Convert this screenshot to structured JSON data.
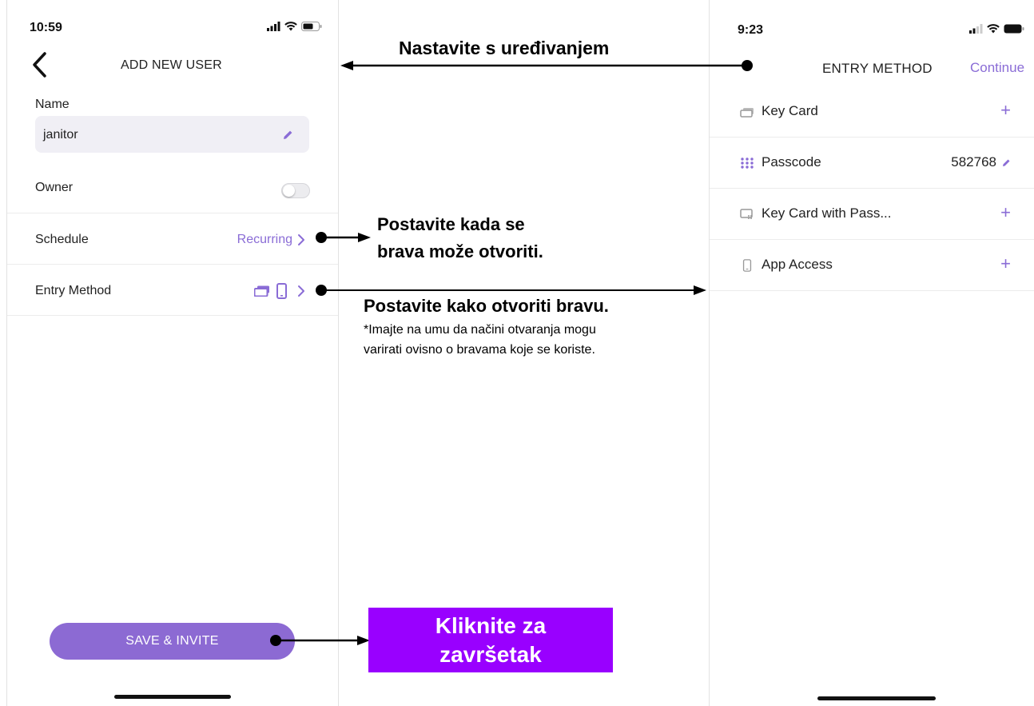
{
  "left_phone": {
    "status_time": "10:59",
    "title": "ADD NEW USER",
    "name_label": "Name",
    "name_value": "janitor",
    "owner_label": "Owner",
    "owner_enabled": false,
    "schedule": {
      "label": "Schedule",
      "value": "Recurring"
    },
    "entry_method": {
      "label": "Entry Method",
      "icons": [
        "key-card-icon",
        "phone-icon"
      ]
    },
    "save_button": "SAVE & INVITE"
  },
  "right_phone": {
    "status_time": "9:23",
    "title": "ENTRY METHOD",
    "continue": "Continue",
    "methods": [
      {
        "label": "Key Card",
        "action": "+",
        "icon": "key-card-icon"
      },
      {
        "label": "Passcode",
        "value": "582768",
        "icon": "keypad-icon"
      },
      {
        "label": "Key Card with Pass...",
        "action": "+",
        "icon": "key-card-keypad-icon"
      },
      {
        "label": "App Access",
        "action": "+",
        "icon": "phone-icon"
      }
    ]
  },
  "annotations": {
    "continue_editing": "Nastavite s uređivanjem",
    "schedule_line1": "Postavite kada se",
    "schedule_line2": "brava može otvoriti.",
    "entry_title": "Postavite kako otvoriti bravu.",
    "entry_note_line1": "*Imajte na umu da načini otvaranja mogu",
    "entry_note_line2": "varirati ovisno o bravama koje se koriste.",
    "finish_line1": "Kliknite za",
    "finish_line2": "završetak"
  },
  "colors": {
    "accent": "#8a6cd6",
    "save_button": "#8c6ad3",
    "callout": "#9900ff"
  }
}
